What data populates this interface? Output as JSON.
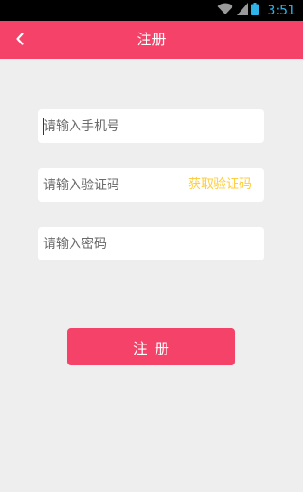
{
  "status_bar": {
    "time": "3:51"
  },
  "header": {
    "title": "注册"
  },
  "form": {
    "phone_placeholder": "请输入手机号",
    "code_placeholder": "请输入验证码",
    "get_code_label": "获取验证码",
    "password_placeholder": "请输入密码",
    "submit_label": "注册"
  },
  "colors": {
    "accent": "#f54269",
    "link": "#ffce3d",
    "background": "#efeeef",
    "clock": "#2fb4e8"
  },
  "icons": [
    "wifi-icon",
    "cell-signal-icon",
    "battery-icon",
    "back-arrow-icon"
  ]
}
